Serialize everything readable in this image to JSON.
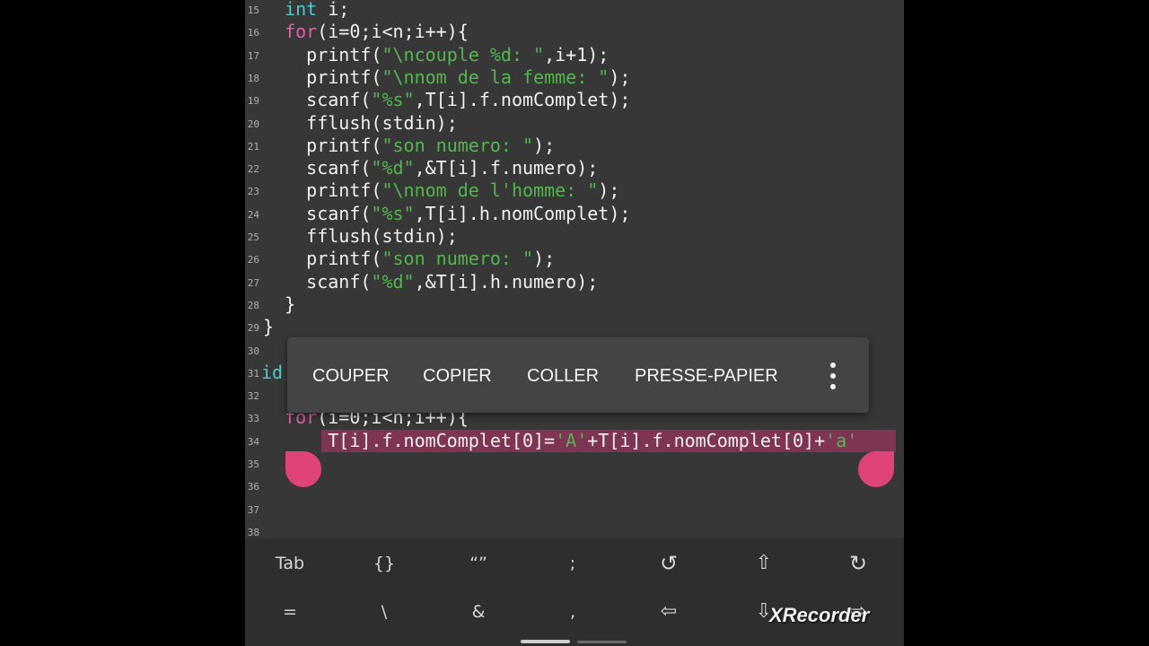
{
  "editor": {
    "lines": [
      {
        "n": "15",
        "indent": "  ",
        "parts": [
          [
            "kw2",
            "int"
          ],
          [
            "p",
            " i;"
          ]
        ]
      },
      {
        "n": "16",
        "indent": "  ",
        "parts": [
          [
            "kw",
            "for"
          ],
          [
            "p",
            "(i=0;i<n;i++){"
          ]
        ]
      },
      {
        "n": "17",
        "indent": "    ",
        "parts": [
          [
            "p",
            "printf("
          ],
          [
            "str",
            "\"\\ncouple %d: \""
          ],
          [
            "p",
            ",i+1);"
          ]
        ]
      },
      {
        "n": "18",
        "indent": "    ",
        "parts": [
          [
            "p",
            "printf("
          ],
          [
            "str",
            "\"\\nnom de la femme: \""
          ],
          [
            "p",
            ");"
          ]
        ]
      },
      {
        "n": "19",
        "indent": "    ",
        "parts": [
          [
            "p",
            "scanf("
          ],
          [
            "str",
            "\"%s\""
          ],
          [
            "p",
            ",T[i].f.nomComplet);"
          ]
        ]
      },
      {
        "n": "20",
        "indent": "    ",
        "parts": [
          [
            "p",
            "fflush(stdin);"
          ]
        ]
      },
      {
        "n": "21",
        "indent": "    ",
        "parts": [
          [
            "p",
            "printf("
          ],
          [
            "str",
            "\"son numero: \""
          ],
          [
            "p",
            ");"
          ]
        ]
      },
      {
        "n": "22",
        "indent": "    ",
        "parts": [
          [
            "p",
            "scanf("
          ],
          [
            "str",
            "\"%d\""
          ],
          [
            "p",
            ",&T[i].f.numero);"
          ]
        ]
      },
      {
        "n": "23",
        "indent": "    ",
        "parts": [
          [
            "p",
            "printf("
          ],
          [
            "str",
            "\"\\nnom de l'homme: \""
          ],
          [
            "p",
            ");"
          ]
        ]
      },
      {
        "n": "24",
        "indent": "    ",
        "parts": [
          [
            "p",
            "scanf("
          ],
          [
            "str",
            "\"%s\""
          ],
          [
            "p",
            ",T[i].h.nomComplet);"
          ]
        ]
      },
      {
        "n": "25",
        "indent": "    ",
        "parts": [
          [
            "p",
            "fflush(stdin);"
          ]
        ]
      },
      {
        "n": "26",
        "indent": "    ",
        "parts": [
          [
            "p",
            "printf("
          ],
          [
            "str",
            "\"son numero: \""
          ],
          [
            "p",
            ");"
          ]
        ]
      },
      {
        "n": "27",
        "indent": "    ",
        "parts": [
          [
            "p",
            "scanf("
          ],
          [
            "str",
            "\"%d\""
          ],
          [
            "p",
            ",&T[i].h.numero);"
          ]
        ]
      },
      {
        "n": "28",
        "indent": "  ",
        "parts": [
          [
            "p",
            "}"
          ]
        ]
      },
      {
        "n": "29",
        "indent": "",
        "parts": [
          [
            "p",
            "}"
          ]
        ]
      },
      {
        "n": "30",
        "indent": "",
        "parts": []
      },
      {
        "n": "31",
        "indent": "",
        "parts": [
          [
            "kw2",
            "id"
          ]
        ]
      },
      {
        "n": "32",
        "indent": "",
        "parts": []
      },
      {
        "n": "33",
        "indent": "  ",
        "parts": [
          [
            "kw",
            "for"
          ],
          [
            "p",
            "(i=0;i<n;i++){"
          ]
        ]
      },
      {
        "n": "34",
        "indent": "      ",
        "parts": [
          [
            "p",
            "T[i].f.nomComplet[0]="
          ],
          [
            "str",
            "'A'"
          ],
          [
            "p",
            "+T[i].f.nomComplet[0]+"
          ],
          [
            "str",
            "'a'"
          ]
        ]
      },
      {
        "n": "35",
        "indent": "",
        "parts": []
      },
      {
        "n": "36",
        "indent": "",
        "parts": []
      },
      {
        "n": "37",
        "indent": "",
        "parts": []
      },
      {
        "n": "38",
        "indent": "",
        "parts": []
      }
    ]
  },
  "context_menu": {
    "cut": "COUPER",
    "copy": "COPIER",
    "paste": "COLLER",
    "clipboard": "PRESSE-PAPIER"
  },
  "keybar": {
    "row1": [
      "Tab",
      "{}",
      "“”",
      ";",
      "↺",
      "⇧",
      "↻"
    ],
    "row2": [
      "=",
      "\\",
      "&",
      ",",
      "⇦",
      "⇩",
      "⇨"
    ]
  },
  "watermark": "XRecorder",
  "colors": {
    "background": "#373737",
    "keyword": "#e05fa8",
    "type": "#4ec9c9",
    "string": "#53b64e",
    "selection": "#7e3553",
    "handle": "#e0427a"
  }
}
